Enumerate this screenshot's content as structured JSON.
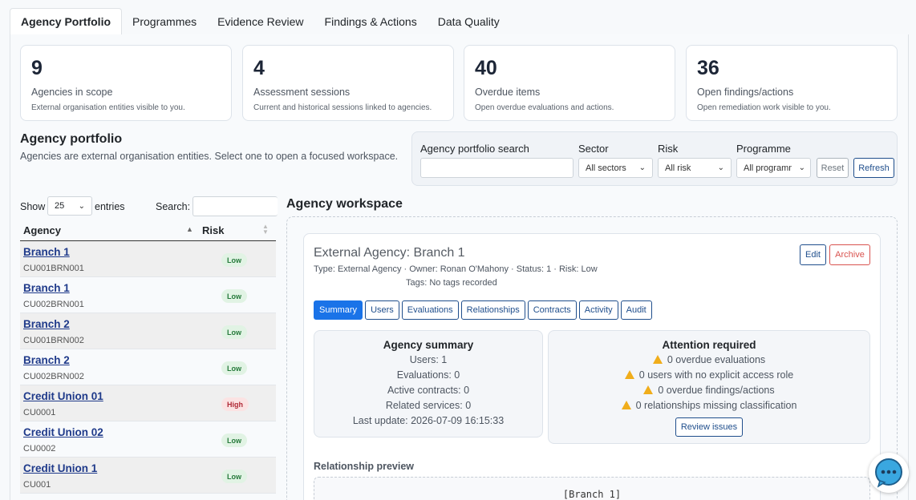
{
  "tabs": [
    {
      "label": "Agency Portfolio"
    },
    {
      "label": "Programmes"
    },
    {
      "label": "Evidence Review"
    },
    {
      "label": "Findings & Actions"
    },
    {
      "label": "Data Quality"
    }
  ],
  "stats": [
    {
      "value": "9",
      "label": "Agencies in scope",
      "sub": "External organisation entities visible to you."
    },
    {
      "value": "4",
      "label": "Assessment sessions",
      "sub": "Current and historical sessions linked to agencies."
    },
    {
      "value": "40",
      "label": "Overdue items",
      "sub": "Open overdue evaluations and actions."
    },
    {
      "value": "36",
      "label": "Open findings/actions",
      "sub": "Open remediation work visible to you."
    }
  ],
  "portfolio": {
    "title": "Agency portfolio",
    "description": "Agencies are external organisation entities. Select one to open a focused workspace."
  },
  "filters": {
    "search_label": "Agency portfolio search",
    "search_value": "",
    "sector_label": "Sector",
    "sector_value": "All sectors",
    "risk_label": "Risk",
    "risk_value": "All risk",
    "programme_label": "Programme",
    "programme_value": "All programmes",
    "reset": "Reset",
    "refresh": "Refresh"
  },
  "table": {
    "show_label": "Show",
    "page_size": "25",
    "entries_label": "entries",
    "search_label": "Search:",
    "col_agency": "Agency",
    "col_risk": "Risk",
    "rows": [
      {
        "name": "Branch 1",
        "code": "CU001BRN001",
        "risk": "Low"
      },
      {
        "name": "Branch 1",
        "code": "CU002BRN001",
        "risk": "Low"
      },
      {
        "name": "Branch 2",
        "code": "CU001BRN002",
        "risk": "Low"
      },
      {
        "name": "Branch 2",
        "code": "CU002BRN002",
        "risk": "Low"
      },
      {
        "name": "Credit Union 01",
        "code": "CU0001",
        "risk": "High"
      },
      {
        "name": "Credit Union 02",
        "code": "CU0002",
        "risk": "Low"
      },
      {
        "name": "Credit Union 1",
        "code": "CU001",
        "risk": "Low"
      }
    ]
  },
  "workspace": {
    "title": "Agency workspace",
    "agency_title": "External Agency: Branch 1",
    "meta": "Type: External Agency · Owner: Ronan O'Mahony · Status: 1 · Risk: Low",
    "tags": "Tags: No tags recorded",
    "edit": "Edit",
    "archive": "Archive",
    "subtabs": [
      "Summary",
      "Users",
      "Evaluations",
      "Relationships",
      "Contracts",
      "Activity",
      "Audit"
    ],
    "summary": {
      "title": "Agency summary",
      "lines": [
        "Users: 1",
        "Evaluations: 0",
        "Active contracts: 0",
        "Related services: 0",
        "Last update: 2026-07-09 16:15:33"
      ]
    },
    "attention": {
      "title": "Attention required",
      "lines": [
        "0 overdue evaluations",
        "0 users with no explicit access role",
        "0 overdue findings/actions",
        "0 relationships missing classification"
      ],
      "button": "Review issues"
    },
    "relationship_title": "Relationship preview",
    "relationship_text": "[Branch 1]"
  }
}
